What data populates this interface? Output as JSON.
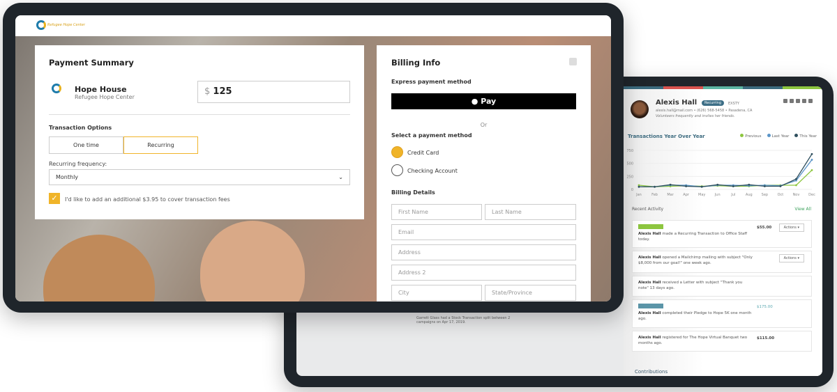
{
  "crm": {
    "strip_colors": [
      "#3b6a7e",
      "#d9534f",
      "#5bb5a2",
      "#3b6a7e",
      "#8dc63f"
    ],
    "name": "Alexis Hall",
    "badge": "Recurring",
    "badge_sub": "EXSTY",
    "contact": "alexis.hall@mail.com  •  (626) 568-5458  •  Pasadena, CA",
    "note": "Volunteers frequently and invites her friends.",
    "chart_title": "Transactions Year Over Year",
    "recent_activity": "Recent Activity",
    "view_all": "View All",
    "activities": [
      {
        "pre": "Alexis Hall",
        "text": " made a Recurring Transaction to Office Staff today.",
        "amount": "$55.00",
        "action": "Actions",
        "bar": "#8dc63f"
      },
      {
        "pre": "Alexis Hall",
        "text": " opened a Mailchimp mailing with subject \"Only $8,000 from our goal!\" one week ago.",
        "amount": "",
        "action": "Actions"
      },
      {
        "pre": "Alexis Hall",
        "text": " received a Letter with subject \"Thank you note\" 13 days ago.",
        "amount": "",
        "action": ""
      },
      {
        "pre": "Alexis Hall",
        "text": " completed their Pledge to Hope 5K one month ago.",
        "amount": "$175.00",
        "action": "",
        "bar": "#5b95a8"
      },
      {
        "pre": "Alexis Hall",
        "text": " registered for The Hope Virtual Banquet two months ago.",
        "amount": "$115.00",
        "action": ""
      }
    ],
    "contributions": "Contributions",
    "garrett": "Garrett Glass had a Stock Transaction split between 2 campaigns on Apr 17, 2019."
  },
  "chart_data": {
    "type": "line",
    "title": "Transactions Year Over Year",
    "legend": "top-right",
    "categories": [
      "Jan",
      "Feb",
      "Mar",
      "Apr",
      "May",
      "Jun",
      "Jul",
      "Aug",
      "Sep",
      "Oct",
      "Nov",
      "Dec"
    ],
    "yticks": [
      "0",
      "250",
      "500",
      "750"
    ],
    "ylim": [
      0,
      750
    ],
    "series": [
      {
        "name": "Previous",
        "color": "#8dc63f",
        "values": [
          80,
          50,
          60,
          70,
          60,
          70,
          60,
          60,
          80,
          80,
          80,
          370
        ]
      },
      {
        "name": "Last Year",
        "color": "#5b95c8",
        "values": [
          50,
          50,
          80,
          80,
          50,
          80,
          80,
          70,
          80,
          70,
          170,
          570
        ]
      },
      {
        "name": "This Year",
        "color": "#2f4f5e",
        "values": [
          50,
          50,
          90,
          60,
          50,
          90,
          60,
          90,
          60,
          60,
          200,
          680
        ]
      }
    ]
  },
  "donate": {
    "logo_text": "Refugee Hope Center",
    "payment_summary": "Payment Summary",
    "org": "Hope House",
    "org_sub": "Refugee Hope Center",
    "currency": "$",
    "amount": "125",
    "transaction_options": "Transaction Options",
    "one_time": "One time",
    "recurring": "Recurring",
    "frequency_label": "Recurring frequency:",
    "frequency": "Monthly",
    "fee_text": "I'd like to add an additional $3.95 to cover transaction fees",
    "billing_info": "Billing Info",
    "express": "Express payment method",
    "apple_pay": " Pay",
    "or": "Or",
    "select_method": "Select a payment method",
    "credit_card": "Credit Card",
    "checking": "Checking Account",
    "billing_details": "Billing Details",
    "placeholders": {
      "first": "First Name",
      "last": "Last Name",
      "email": "Email",
      "address": "Address",
      "address2": "Address 2",
      "city": "City",
      "state": "State/Province"
    },
    "accent": "#f0b429"
  }
}
